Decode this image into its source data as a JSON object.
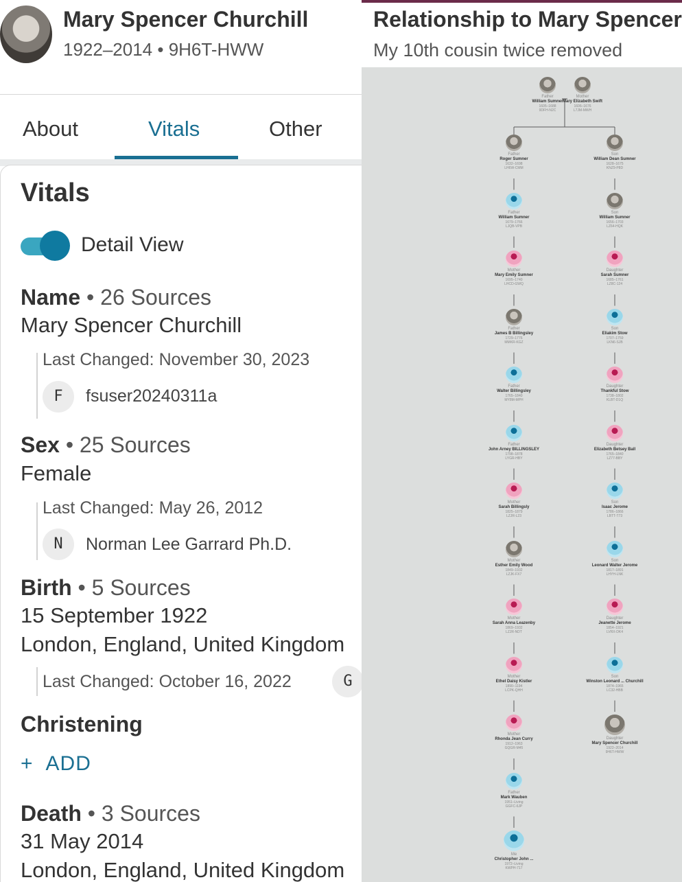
{
  "person": {
    "name": "Mary Spencer Churchill",
    "meta": "1922–2014 • 9H6T-HWW"
  },
  "tabs": [
    "About",
    "Vitals",
    "Other"
  ],
  "active_tab": "Vitals",
  "vitals": {
    "title": "Vitals",
    "detail_view_label": "Detail View",
    "detail_view_on": true,
    "name_fact": {
      "label": "Name",
      "sources": "• 26 Sources",
      "value": "Mary Spencer Churchill",
      "last_changed": "Last Changed: November 30, 2023",
      "user_initial": "F",
      "user_name": "fsuser20240311a"
    },
    "sex_fact": {
      "label": "Sex",
      "sources": "• 25 Sources",
      "value": "Female",
      "last_changed": "Last Changed: May 26, 2012",
      "user_initial": "N",
      "user_name": "Norman Lee Garrard Ph.D."
    },
    "birth_fact": {
      "label": "Birth",
      "sources": "• 5 Sources",
      "date": "15 September 1922",
      "place": "London, England, United Kingdom",
      "last_changed": "Last Changed: October 16, 2022",
      "user_initial": "G"
    },
    "christening": {
      "label": "Christening",
      "add_plus": "+",
      "add_label": "ADD"
    },
    "death_fact": {
      "label": "Death",
      "sources": "• 3 Sources",
      "date": "31 May 2014",
      "place": "London, England, United Kingdom"
    }
  },
  "relationship": {
    "title": "Relationship to Mary Spencer Churchill",
    "subtitle": "My 10th cousin twice removed",
    "top": [
      {
        "role": "Father",
        "name": "William Sumner",
        "dates": "1605–1688",
        "id": "9DFH-N2C",
        "kind": "photo"
      },
      {
        "role": "Mother",
        "name": "Mary Elizabeth Swift",
        "dates": "1606–1676",
        "id": "L7JM-MWH",
        "kind": "photo"
      }
    ],
    "left": [
      {
        "role": "Father",
        "name": "Roger Sumner",
        "dates": "1632–1698",
        "id": "LH6W-CMM",
        "kind": "photo"
      },
      {
        "role": "Father",
        "name": "William Sumner",
        "dates": "1679–1766",
        "id": "LJQB-VPB",
        "kind": "male"
      },
      {
        "role": "Mother",
        "name": "Mary Emily Sumner",
        "dates": "1695–1740",
        "id": "LHCD-GWQ",
        "kind": "female"
      },
      {
        "role": "Father",
        "name": "James B Billingsley",
        "dates": "1729–1776",
        "id": "MMKR-KGZ",
        "kind": "photo"
      },
      {
        "role": "Father",
        "name": "Walter Billingsley",
        "dates": "1765–1840",
        "id": "MY8M-MPH",
        "kind": "male"
      },
      {
        "role": "Father",
        "name": "John Arney BILLINGSLEY",
        "dates": "1798–1878",
        "id": "LYGR-HBY",
        "kind": "male"
      },
      {
        "role": "Mother",
        "name": "Sarah Billingsly",
        "dates": "1825–1879",
        "id": "LZJR-L23",
        "kind": "female"
      },
      {
        "role": "Mother",
        "name": "Esther Emily Wood",
        "dates": "1849–1932",
        "id": "LZJK-FX7",
        "kind": "photo"
      },
      {
        "role": "Mother",
        "name": "Sarah Anna Leazenby",
        "dates": "1869–1932",
        "id": "LZJR-NDT",
        "kind": "female"
      },
      {
        "role": "Mother",
        "name": "Ethel Daisy Kistler",
        "dates": "1890–1194",
        "id": "LCPK-QHH",
        "kind": "female"
      },
      {
        "role": "Mother",
        "name": "Rhonda Jean Curry",
        "dates": "1912–1963",
        "id": "GQGR-M45",
        "kind": "female"
      },
      {
        "role": "Father",
        "name": "Mark Wauben",
        "dates": "1951–Living",
        "id": "GGFC-6JP",
        "kind": "male"
      },
      {
        "role": "Me",
        "name": "Christopher John ...",
        "dates": "1972–Living",
        "id": "KWPH-717",
        "kind": "male"
      }
    ],
    "right": [
      {
        "role": "Son",
        "name": "William Dean Sumner",
        "dates": "1628–1675",
        "id": "KNZ9-P8D",
        "kind": "photo"
      },
      {
        "role": "Son",
        "name": "William Sumner",
        "dates": "1656–1703",
        "id": "LZ64-HQK",
        "kind": "photo"
      },
      {
        "role": "Daughter",
        "name": "Sarah Sumner",
        "dates": "1685–1761",
        "id": "LZ8C-124",
        "kind": "female"
      },
      {
        "role": "Son",
        "name": "Eliakim Stow",
        "dates": "1707–1759",
        "id": "LKN6-SJB",
        "kind": "male"
      },
      {
        "role": "Daughter",
        "name": "Thankful Stow",
        "dates": "1738–1802",
        "id": "KLBT-D1Q",
        "kind": "female"
      },
      {
        "role": "Daughter",
        "name": "Elizabeth Betsey Ball",
        "dates": "1765–1840",
        "id": "LZ77-BBY",
        "kind": "female"
      },
      {
        "role": "Son",
        "name": "Isaac Jerome",
        "dates": "1786–1866",
        "id": "LBTT-T73",
        "kind": "male"
      },
      {
        "role": "Son",
        "name": "Leonard Walter Jerome",
        "dates": "1817–1891",
        "id": "LHYH-LNK",
        "kind": "male"
      },
      {
        "role": "Daughter",
        "name": "Jeanette Jerome",
        "dates": "1854–1921",
        "id": "LVRX-DK4",
        "kind": "female"
      },
      {
        "role": "Son",
        "name": "Winston Leonard ... Churchill",
        "dates": "1874–1965",
        "id": "LC32-HBB",
        "kind": "male"
      },
      {
        "role": "Daughter",
        "name": "Mary Spencer Churchill",
        "dates": "1922–2014",
        "id": "9H6T-HWW",
        "kind": "photo"
      }
    ]
  }
}
